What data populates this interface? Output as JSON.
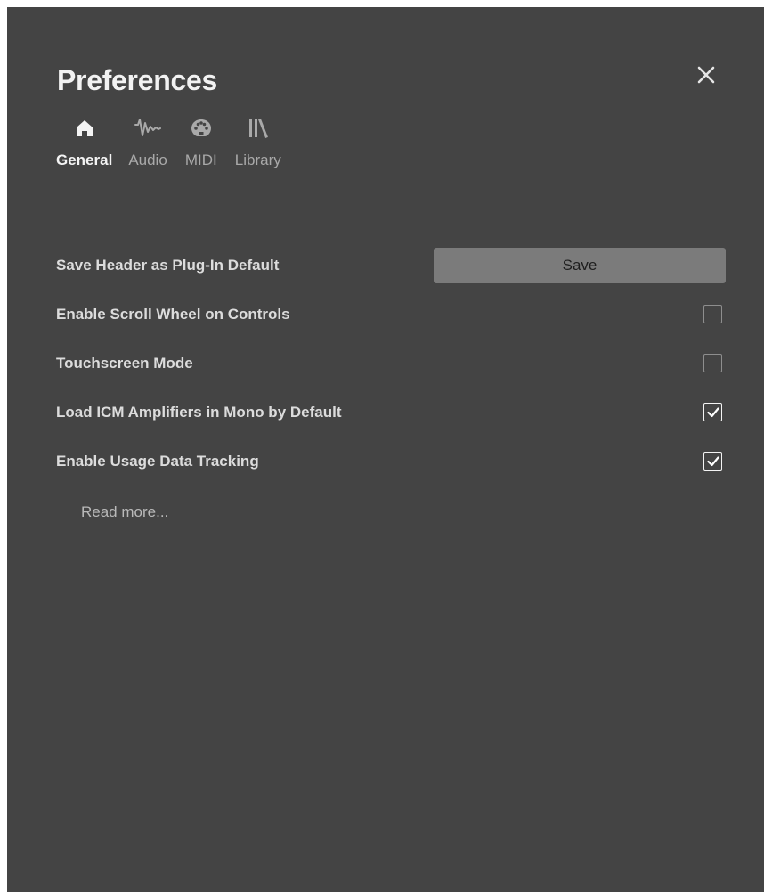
{
  "dialog": {
    "title": "Preferences",
    "close_icon": "close-icon"
  },
  "tabs": [
    {
      "label": "General",
      "icon": "home-icon",
      "active": true
    },
    {
      "label": "Audio",
      "icon": "waveform-icon",
      "active": false
    },
    {
      "label": "MIDI",
      "icon": "midi-port-icon",
      "active": false
    },
    {
      "label": "Library",
      "icon": "library-icon",
      "active": false
    }
  ],
  "settings": {
    "save_header": {
      "label": "Save Header as Plug-In Default",
      "button_label": "Save"
    },
    "scroll_wheel": {
      "label": "Enable Scroll Wheel on Controls",
      "checked": false
    },
    "touchscreen": {
      "label": "Touchscreen Mode",
      "checked": false
    },
    "icm_mono": {
      "label": "Load ICM Amplifiers in Mono by Default",
      "checked": true
    },
    "usage_tracking": {
      "label": "Enable Usage Data Tracking",
      "checked": true
    }
  },
  "read_more": "Read more...",
  "colors": {
    "background": "#444444",
    "text_primary": "#f2f2f2",
    "text_muted": "#a9a9a9",
    "button_bg": "#7b7b7b"
  }
}
